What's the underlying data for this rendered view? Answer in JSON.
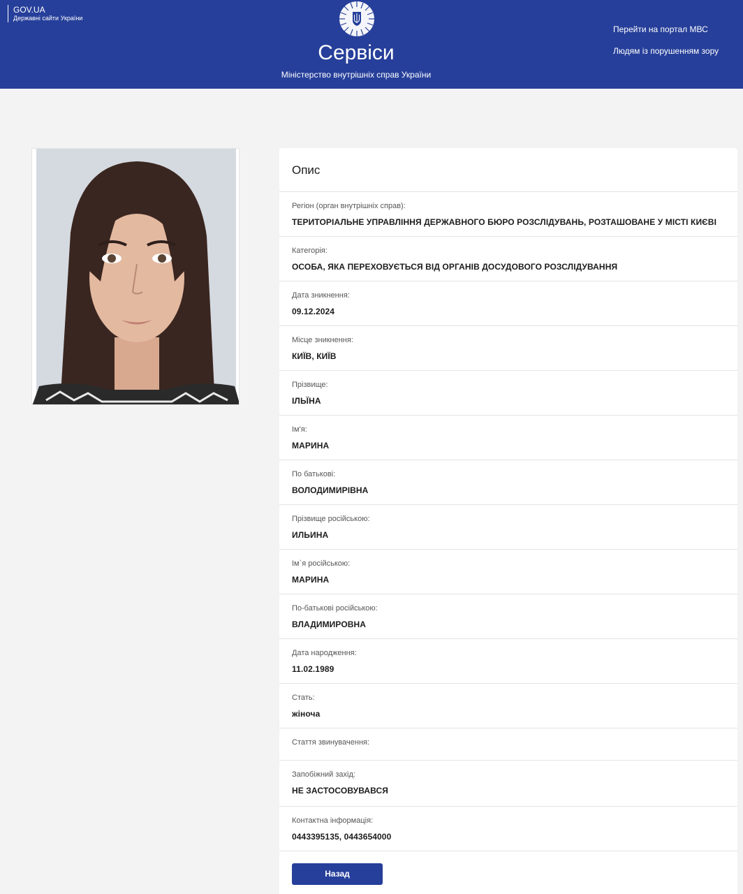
{
  "header": {
    "gov_title": "GOV.UA",
    "gov_subtitle": "Державні сайти України",
    "brand": "Сервіси",
    "ministry": "Міністерство внутрішніх справ України",
    "links": [
      "Перейти на портал МВС",
      "Людям із порушенням зору"
    ]
  },
  "card": {
    "title": "Опис",
    "fields": [
      {
        "label": "Регіон (орган внутрішніх справ):",
        "value": "ТЕРИТОРІАЛЬНЕ УПРАВЛІННЯ ДЕРЖАВНОГО БЮРО РОЗСЛІДУВАНЬ, РОЗТАШОВАНЕ У МІСТІ КИЄВІ"
      },
      {
        "label": "Категорія:",
        "value": "ОСОБА, ЯКА ПЕРЕХОВУЄТЬСЯ ВІД ОРГАНІВ ДОСУДОВОГО РОЗСЛІДУВАННЯ"
      },
      {
        "label": "Дата зникнення:",
        "value": "09.12.2024"
      },
      {
        "label": "Місце зникнення:",
        "value": "КИЇВ, КИЇВ"
      },
      {
        "label": "Прізвище:",
        "value": "ІЛЬЇНА"
      },
      {
        "label": "Ім'я:",
        "value": "МАРИНА"
      },
      {
        "label": "По батькові:",
        "value": "ВОЛОДИМИРІВНА"
      },
      {
        "label": "Прізвище російською:",
        "value": "ИЛЬИНА"
      },
      {
        "label": "Ім`я російською:",
        "value": "МАРИНА"
      },
      {
        "label": "По-батькові російською:",
        "value": "ВЛАДИМИРОВНА"
      },
      {
        "label": "Дата народження:",
        "value": "11.02.1989"
      },
      {
        "label": "Стать:",
        "value": "жіноча"
      },
      {
        "label": "Стаття звинувачення:",
        "value": ""
      },
      {
        "label": "Запобіжний захід:",
        "value": "НЕ ЗАСТОСОВУВАВСЯ"
      },
      {
        "label": "Контактна інформація:",
        "value": "0443395135, 0443654000"
      }
    ],
    "back_label": "Назад"
  },
  "colors": {
    "header_bg": "#263f9a",
    "page_bg": "#f3f3f3",
    "button_bg": "#263f9a"
  },
  "icons": {
    "emblem": "trident-emblem-icon"
  }
}
